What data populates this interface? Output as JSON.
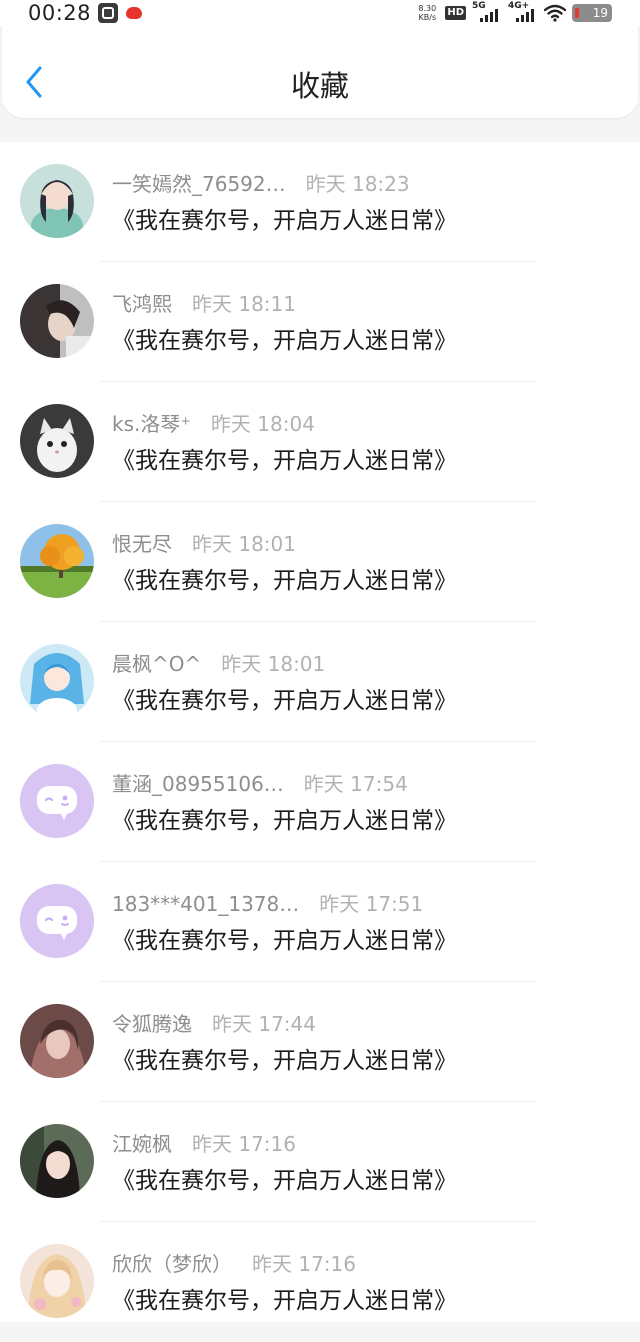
{
  "status_bar": {
    "time": "00:28",
    "net_speed_value": "8.30",
    "net_speed_unit": "KB/s",
    "hd_label": "HD",
    "network_label_1": "5G",
    "network_label_2": "4G+",
    "battery_level": "19"
  },
  "header": {
    "title": "收藏",
    "back_icon": "chevron-left-icon"
  },
  "accent_color": "#2196f3",
  "favorites": [
    {
      "name": "一笑嫣然_76592…",
      "time": "昨天 18:23",
      "message": "《我在赛尔号，开启万人迷日常》",
      "avatar": "photo"
    },
    {
      "name": "飞鸿熙",
      "time": "昨天 18:11",
      "message": "《我在赛尔号，开启万人迷日常》",
      "avatar": "photo"
    },
    {
      "name": "ks.洛琴⁺",
      "time": "昨天 18:04",
      "message": "《我在赛尔号，开启万人迷日常》",
      "avatar": "photo"
    },
    {
      "name": "恨无尽",
      "time": "昨天 18:01",
      "message": "《我在赛尔号，开启万人迷日常》",
      "avatar": "photo"
    },
    {
      "name": "晨枫^O^",
      "time": "昨天 18:01",
      "message": "《我在赛尔号，开启万人迷日常》",
      "avatar": "photo"
    },
    {
      "name": "董涵_08955106…",
      "time": "昨天 17:54",
      "message": "《我在赛尔号，开启万人迷日常》",
      "avatar": "default-chat-bubble-icon"
    },
    {
      "name": "183***401_1378…",
      "time": "昨天 17:51",
      "message": "《我在赛尔号，开启万人迷日常》",
      "avatar": "default-chat-bubble-icon"
    },
    {
      "name": "令狐腾逸",
      "time": "昨天 17:44",
      "message": "《我在赛尔号，开启万人迷日常》",
      "avatar": "photo"
    },
    {
      "name": "江婉枫",
      "time": "昨天 17:16",
      "message": "《我在赛尔号，开启万人迷日常》",
      "avatar": "photo"
    },
    {
      "name": "欣欣（梦欣）",
      "time": "昨天 17:16",
      "message": "《我在赛尔号，开启万人迷日常》",
      "avatar": "photo"
    }
  ]
}
